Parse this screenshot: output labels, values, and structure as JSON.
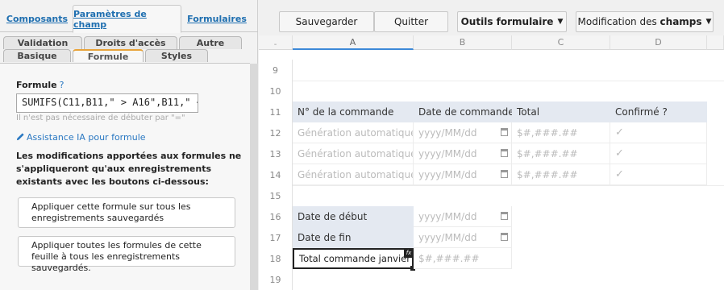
{
  "left_panel": {
    "top_tabs": [
      "Composants",
      "Paramètres de champ",
      "Formulaires"
    ],
    "sub_tabs_row1": [
      "Validation",
      "Droits d'accès",
      "Autre"
    ],
    "sub_tabs_row2": [
      "Basique",
      "Formule",
      "Styles"
    ],
    "formula_label": "Formule",
    "help_mark": "?",
    "formula_value": "SUMIFS(C11,B11,\" > A16\",B11,\" <",
    "formula_hint": "Il n'est pas nécessaire de débuter par \"=\"",
    "ai_link": "Assistance IA pour formule",
    "warning_text": "Les modifications apportées aux formules ne s'appliqueront qu'aux enregistrements existants avec les boutons ci-dessous:",
    "apply_one_button": "Appliquer cette formule sur tous les enregistrements sauvegardés",
    "apply_all_button": "Appliquer toutes les formules de cette feuille à tous les enregistrements sauvegardés."
  },
  "toolbar": {
    "save": "Sauvegarder",
    "quit": "Quitter",
    "form_tools": "Outils formulaire",
    "modify_prefix": "Modification des ",
    "modify_bold": "champs"
  },
  "grid": {
    "corner": "-",
    "columns": [
      "A",
      "B",
      "C",
      "D"
    ],
    "rows": [
      "9",
      "10",
      "11",
      "12",
      "13",
      "14",
      "15",
      "16",
      "17",
      "18",
      "19"
    ],
    "headers": [
      "N° de la commande",
      "Date de commande",
      "Total",
      "Confirmé ?"
    ],
    "placeholders": {
      "auto": "Génération automatique",
      "date": "yyyy/MM/dd",
      "money": "$#,###.##",
      "check": "✓"
    },
    "labels": {
      "start": "Date de début",
      "end": "Date de fin",
      "total_jan": "Total commande janvier"
    },
    "fx_badge": "fx"
  }
}
